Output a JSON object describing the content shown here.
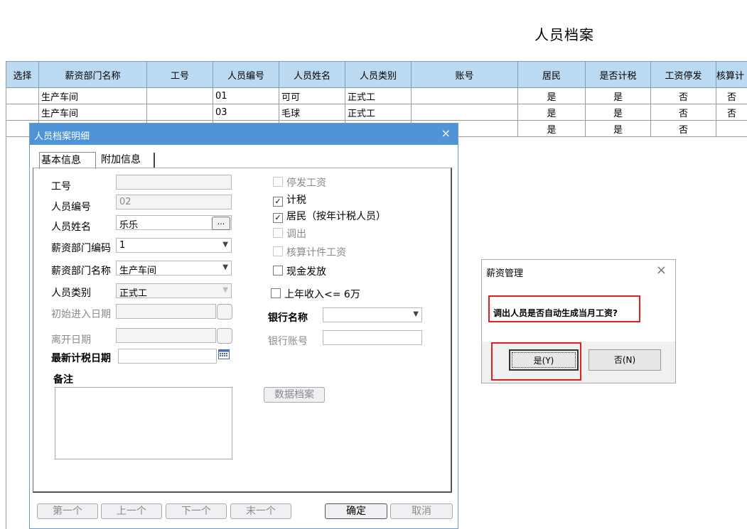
{
  "page_title": "人员档案",
  "grid": {
    "headers": [
      "选择",
      "薪资部门名称",
      "工号",
      "人员编号",
      "人员姓名",
      "人员类别",
      "账号",
      "居民",
      "是否计税",
      "工资停发",
      "核算计"
    ],
    "rows": [
      [
        "",
        "生产车间",
        "",
        "01",
        "可可",
        "正式工",
        "",
        "是",
        "是",
        "否",
        "否"
      ],
      [
        "",
        "生产车间",
        "",
        "03",
        "毛球",
        "正式工",
        "",
        "是",
        "是",
        "否",
        "否"
      ],
      [
        "",
        "",
        "",
        "",
        "",
        "",
        "",
        "是",
        "是",
        "否",
        ""
      ]
    ]
  },
  "detail": {
    "title": "人员档案明细",
    "close_glyph": "×",
    "tabs": [
      "基本信息",
      "附加信息"
    ],
    "fields": {
      "work_no": {
        "label": "工号",
        "value": ""
      },
      "person_no": {
        "label": "人员编号",
        "value": "02"
      },
      "person_name": {
        "label": "人员姓名",
        "value": "乐乐",
        "button": "..."
      },
      "dept_code": {
        "label": "薪资部门编码",
        "value": "1"
      },
      "dept_name": {
        "label": "薪资部门名称",
        "value": "生产车间"
      },
      "person_type": {
        "label": "人员类别",
        "value": "正式工"
      },
      "start_date": {
        "label": "初始进入日期",
        "value": ""
      },
      "leave_date": {
        "label": "离开日期",
        "value": ""
      },
      "tax_date": {
        "label": "最新计税日期",
        "value": ""
      },
      "remark": {
        "label": "备注",
        "value": ""
      },
      "bank_name": {
        "label": "银行名称",
        "value": ""
      },
      "bank_account": {
        "label": "银行账号",
        "value": ""
      }
    },
    "checks": [
      {
        "label": "停发工资",
        "checked": false,
        "disabled": true
      },
      {
        "label": "计税",
        "checked": true,
        "disabled": false
      },
      {
        "label": "居民（按年计税人员）",
        "checked": true,
        "disabled": false
      },
      {
        "label": "调出",
        "checked": false,
        "disabled": true
      },
      {
        "label": "核算计件工资",
        "checked": false,
        "disabled": true
      },
      {
        "label": "现金发放",
        "checked": false,
        "disabled": false
      },
      {
        "label": "上年收入<= 6万",
        "checked": false,
        "disabled": false
      }
    ],
    "check_glyph": "✓",
    "data_button": "数据档案",
    "nav": [
      "第一个",
      "上一个",
      "下一个",
      "末一个"
    ],
    "ok": "确定",
    "cancel": "取消"
  },
  "message": {
    "title": "薪资管理",
    "close_glyph": "×",
    "text": "调出人员是否自动生成当月工资?",
    "yes": "是(Y)",
    "no": "否(N)"
  }
}
